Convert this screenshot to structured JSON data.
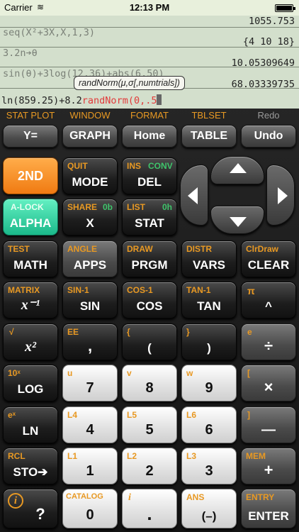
{
  "status": {
    "carrier": "Carrier",
    "time": "12:13 PM"
  },
  "screen": {
    "history": [
      {
        "expr": "",
        "result": "1055.753"
      },
      {
        "expr": "seq(X²+3X,X,1,3)",
        "result": "{4 10 18}"
      },
      {
        "expr": "3.2n➔θ",
        "result": "10.05309649"
      },
      {
        "expr": "sin(θ)+3log(12,36)+abs(6.50)",
        "result": "68.03339735"
      }
    ],
    "input_prefix": "ln(859.25)+8.2",
    "input_function": "randNorm(0,.5",
    "tooltip": "randNorm(μ,σ[,numtrials])"
  },
  "top_labels": [
    "STAT PLOT",
    "WINDOW",
    "FORMAT",
    "TBLSET",
    "Redo"
  ],
  "top_keys": [
    "Y=",
    "GRAPH",
    "Home",
    "TABLE",
    "Undo"
  ],
  "keys": {
    "k2nd": "2ND",
    "mode": {
      "main": "MODE",
      "top": "QUIT"
    },
    "del": {
      "main": "DEL",
      "top": "INS",
      "top2": "CONV"
    },
    "alpha": {
      "main": "ALPHA",
      "top": "A-LOCK"
    },
    "x": {
      "main": "X",
      "top": "SHARE",
      "top2": "0b"
    },
    "stat": {
      "main": "STAT",
      "top": "LIST",
      "top2": "0h"
    },
    "math": {
      "main": "MATH",
      "top": "TEST"
    },
    "apps": {
      "main": "APPS",
      "top": "ANGLE"
    },
    "prgm": {
      "main": "PRGM",
      "top": "DRAW"
    },
    "vars": {
      "main": "VARS",
      "top": "DISTR"
    },
    "clear": {
      "main": "CLEAR",
      "top": "ClrDraw"
    },
    "inv": {
      "main": "x⁻¹",
      "top": "MATRIX"
    },
    "sin": {
      "main": "SIN",
      "top": "SIN-1"
    },
    "cos": {
      "main": "COS",
      "top": "COS-1"
    },
    "tan": {
      "main": "TAN",
      "top": "TAN-1"
    },
    "pow": {
      "main": "^",
      "top": "π"
    },
    "sq": {
      "main": "x²",
      "top": "√"
    },
    "comma": {
      "main": ",",
      "top": "EE"
    },
    "lp": {
      "main": "(",
      "top": "{"
    },
    "rp": {
      "main": ")",
      "top": "}"
    },
    "div": {
      "main": "÷",
      "top": "e"
    },
    "log": {
      "main": "LOG",
      "top": "10ˣ"
    },
    "n7": {
      "main": "7",
      "top": "u"
    },
    "n8": {
      "main": "8",
      "top": "v"
    },
    "n9": {
      "main": "9",
      "top": "w"
    },
    "mul": {
      "main": "×",
      "top": "["
    },
    "ln": {
      "main": "LN",
      "top": "eˣ"
    },
    "n4": {
      "main": "4",
      "top": "L4"
    },
    "n5": {
      "main": "5",
      "top": "L5"
    },
    "n6": {
      "main": "6",
      "top": "L6"
    },
    "sub": {
      "main": "—",
      "top": "]"
    },
    "sto": {
      "main": "STO➔",
      "top": "RCL"
    },
    "n1": {
      "main": "1",
      "top": "L1"
    },
    "n2": {
      "main": "2",
      "top": "L2"
    },
    "n3": {
      "main": "3",
      "top": "L3"
    },
    "add": {
      "main": "+",
      "top": "MEM"
    },
    "help": {
      "main": "?",
      "top": "i"
    },
    "n0": {
      "main": "0",
      "top": "CATALOG"
    },
    "dot": {
      "main": ".",
      "top": "i"
    },
    "neg": {
      "main": "(–)",
      "top": "ANS"
    },
    "enter": {
      "main": "ENTER",
      "top": "ENTRY"
    }
  },
  "colors": {
    "screen": "#d3dfcc",
    "accent_orange": "#e89923",
    "accent_green": "#3fc46b",
    "error_red": "#e23b3b"
  }
}
